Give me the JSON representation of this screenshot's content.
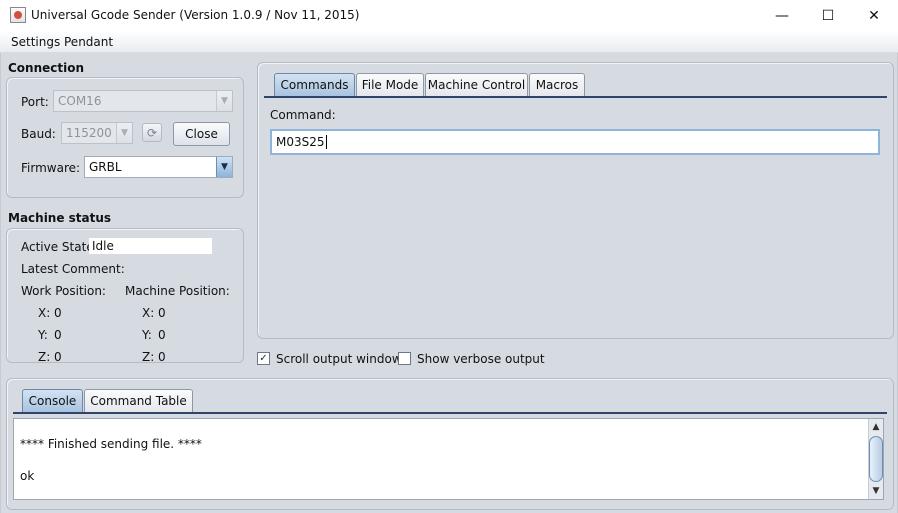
{
  "window": {
    "title": "Universal Gcode Sender (Version 1.0.9 / Nov 11, 2015)",
    "controls": {
      "minimize": "—",
      "maximize": "☐",
      "close": "✕"
    }
  },
  "menu": {
    "items": [
      "Settings",
      "Pendant"
    ]
  },
  "connection": {
    "title": "Connection",
    "port_label": "Port:",
    "port_value": "COM16",
    "baud_label": "Baud:",
    "baud_value": "115200",
    "refresh_icon": "refresh-icon",
    "close_button": "Close",
    "firmware_label": "Firmware:",
    "firmware_value": "GRBL"
  },
  "machine_status": {
    "title": "Machine status",
    "active_state_label": "Active State:",
    "active_state_value": "Idle",
    "latest_comment_label": "Latest Comment:",
    "work_position_label": "Work Position:",
    "machine_position_label": "Machine Position:",
    "work": [
      {
        "axis": "X:",
        "value": "0"
      },
      {
        "axis": "Y:",
        "value": "0"
      },
      {
        "axis": "Z:",
        "value": "0"
      }
    ],
    "machine": [
      {
        "axis": "X:",
        "value": "0"
      },
      {
        "axis": "Y:",
        "value": "0"
      },
      {
        "axis": "Z:",
        "value": "0"
      }
    ]
  },
  "main_tabs": {
    "tabs": [
      "Commands",
      "File Mode",
      "Machine Control",
      "Macros"
    ],
    "selected": "Commands",
    "command_label": "Command:",
    "command_value": "M03S25"
  },
  "options": {
    "scroll_output": {
      "label": "Scroll output window",
      "checked": true
    },
    "verbose_output": {
      "label": "Show verbose output",
      "checked": false
    }
  },
  "console": {
    "tabs": [
      "Console",
      "Command Table"
    ],
    "selected": "Console",
    "lines": [
      "**** Finished sending file. ****",
      "ok"
    ]
  },
  "colors": {
    "window_bg": "#d6dbe2",
    "selected_tab": "#a9c3df",
    "focus_border": "#8eb4dd"
  }
}
